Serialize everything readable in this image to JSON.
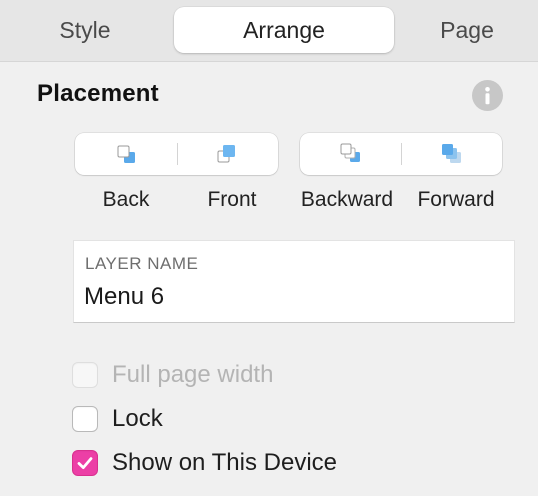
{
  "tabs": {
    "style": "Style",
    "arrange": "Arrange",
    "page": "Page",
    "selected": "Arrange"
  },
  "placement": {
    "title": "Placement",
    "info_icon": "info-icon",
    "buttons": {
      "back": {
        "label": "Back",
        "icon": "send-to-back-icon"
      },
      "front": {
        "label": "Front",
        "icon": "bring-to-front-icon"
      },
      "backward": {
        "label": "Backward",
        "icon": "send-backward-icon"
      },
      "forward": {
        "label": "Forward",
        "icon": "bring-forward-icon"
      }
    }
  },
  "layer_name": {
    "label": "LAYER NAME",
    "value": "Menu 6"
  },
  "options": {
    "full_page_width": {
      "label": "Full page width",
      "checked": false,
      "disabled": true
    },
    "lock": {
      "label": "Lock",
      "checked": false,
      "disabled": false
    },
    "show_on_device": {
      "label": "Show on This Device",
      "checked": true,
      "disabled": false
    }
  },
  "colors": {
    "accent_pink": "#ec3fa6",
    "icon_blue": "#5aa9ea",
    "panel_bg": "#f0f0f0"
  }
}
